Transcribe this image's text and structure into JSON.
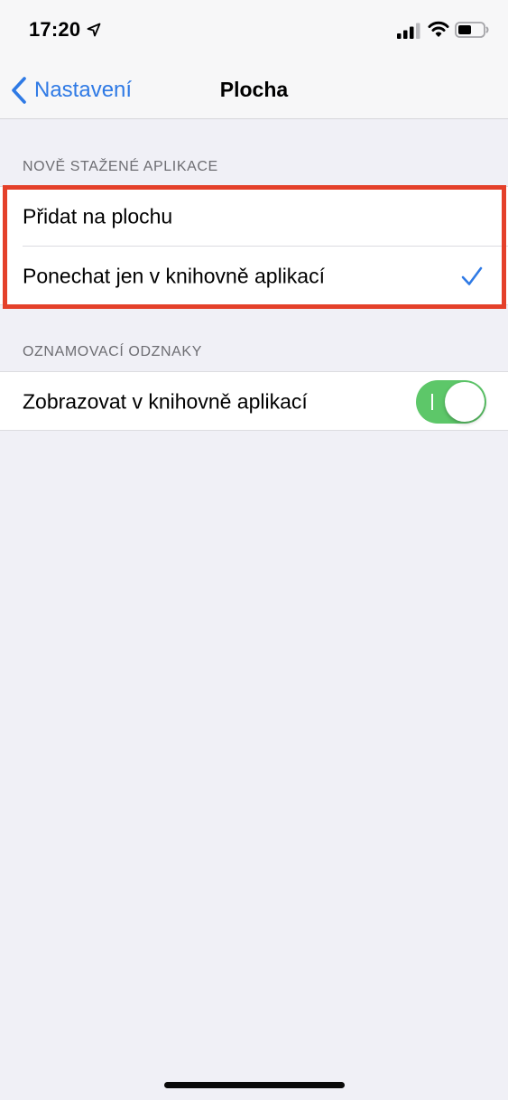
{
  "status_bar": {
    "time": "17:20",
    "icons": [
      "location-arrow-icon",
      "cellular-signal-icon",
      "wifi-icon",
      "battery-icon"
    ]
  },
  "nav": {
    "back_label": "Nastavení",
    "title": "Plocha"
  },
  "sections": [
    {
      "header": "NOVĚ STAŽENÉ APLIKACE",
      "rows": [
        {
          "label": "Přidat na plochu",
          "selected": false
        },
        {
          "label": "Ponechat jen v knihovně aplikací",
          "selected": true
        }
      ]
    },
    {
      "header": "OZNAMOVACÍ ODZNAKY",
      "rows": [
        {
          "label": "Zobrazovat v knihovně aplikací",
          "toggle_on": true
        }
      ]
    }
  ],
  "colors": {
    "accent": "#2f7ae5",
    "toggle_on": "#5dc769",
    "highlight": "#e4402a",
    "background": "#f0f0f6"
  }
}
